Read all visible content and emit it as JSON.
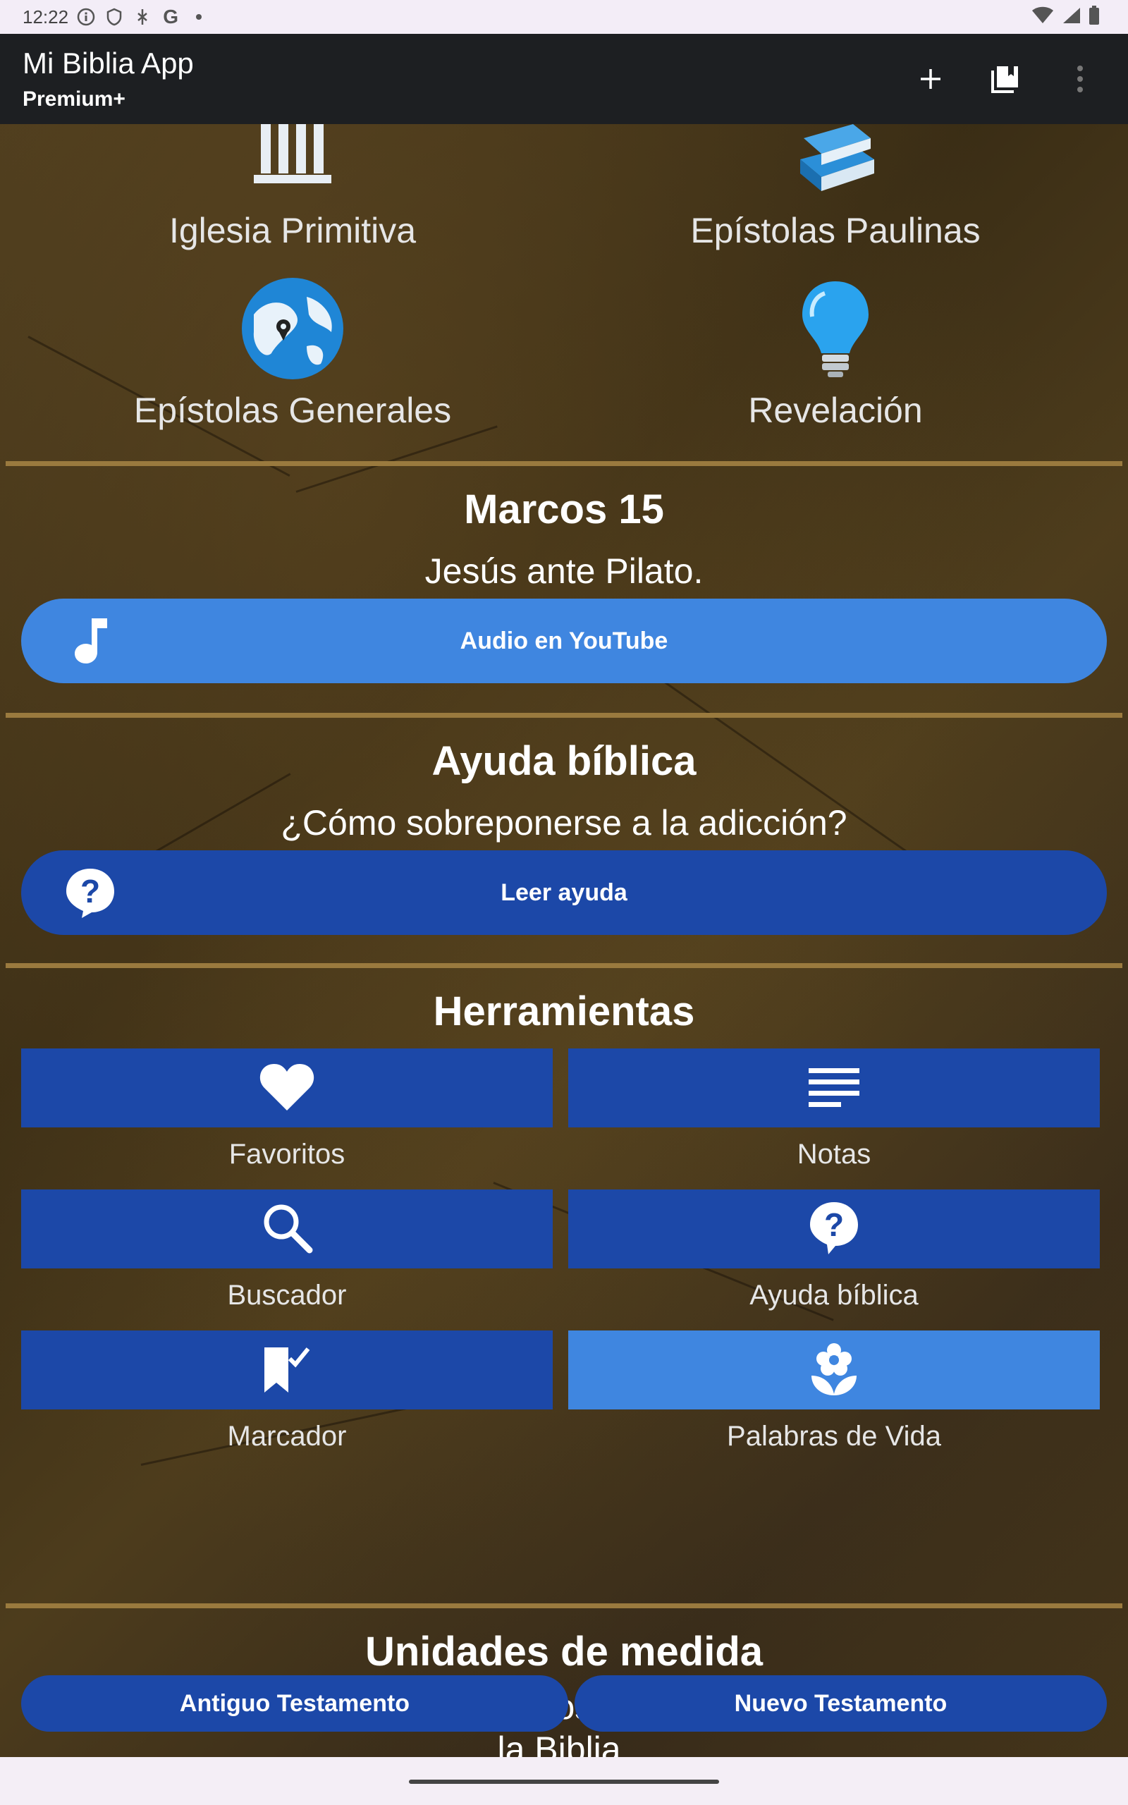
{
  "status": {
    "time": "12:22",
    "left_icons": [
      "info-icon",
      "shield-icon",
      "nfc-icon",
      "google-icon",
      "dot-icon"
    ],
    "right_icons": [
      "wifi-icon",
      "signal-icon",
      "battery-icon"
    ]
  },
  "appbar": {
    "title": "Mi Biblia App",
    "subtitle": "Premium+",
    "actions": [
      "add-icon",
      "library-icon",
      "more-vert-icon"
    ]
  },
  "books": [
    {
      "label": "Iglesia Primitiva",
      "icon": "columns-icon"
    },
    {
      "label": "Epístolas Paulinas",
      "icon": "books-icon"
    },
    {
      "label": "Epístolas Generales",
      "icon": "globe-icon"
    },
    {
      "label": "Revelación",
      "icon": "lightbulb-icon"
    }
  ],
  "chapter": {
    "title": "Marcos 15",
    "subtitle": "Jesús ante Pilato.",
    "button_label": "Audio en YouTube",
    "button_icon": "music-note-icon",
    "button_color": "#3f86e0"
  },
  "help": {
    "title": "Ayuda bíblica",
    "subtitle": "¿Cómo sobreponerse a la adicción?",
    "button_label": "Leer ayuda",
    "button_icon": "help-circle-icon",
    "button_color": "#1c48a8"
  },
  "tools": {
    "title": "Herramientas",
    "items": [
      {
        "label": "Favoritos",
        "icon": "heart-icon",
        "color": "#1c48a8"
      },
      {
        "label": "Notas",
        "icon": "notes-icon",
        "color": "#1c48a8"
      },
      {
        "label": "Buscador",
        "icon": "search-icon",
        "color": "#1c48a8"
      },
      {
        "label": "Ayuda bíblica",
        "icon": "help-icon",
        "color": "#1c48a8"
      },
      {
        "label": "Marcador",
        "icon": "bookmark-icon",
        "color": "#1c48a8"
      },
      {
        "label": "Palabras de Vida",
        "icon": "flower-icon",
        "color": "#3f86e0"
      }
    ]
  },
  "units": {
    "title": "Unidades de medida",
    "description": "Se incluyen solamente los términos más comunes mencionados en la Biblia.",
    "old_testament_label": "Antiguo Testamento",
    "new_testament_label": "Nuevo Testamento"
  }
}
